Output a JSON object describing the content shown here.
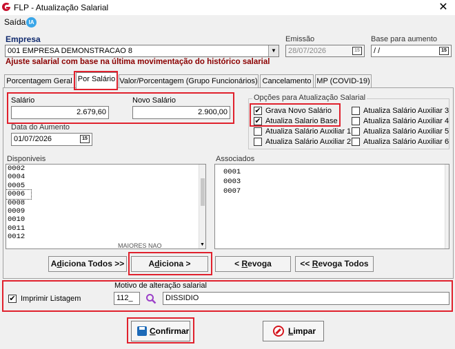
{
  "window": {
    "title": "FLP - Atualização Salarial",
    "close_glyph": "✕"
  },
  "menu": {
    "saida": "Saída",
    "ia_badge": "IA"
  },
  "empresa": {
    "label": "Empresa",
    "value": "001 EMPRESA DEMONSTRACAO 8",
    "emissao_label": "Emissão",
    "emissao_value": "28/07/2026",
    "base_label": "Base para aumento",
    "base_value": " / /"
  },
  "warning": "Ajuste salarial com base na última movimentação do histórico salarial",
  "tabs": [
    {
      "label": "Porcentagem Geral"
    },
    {
      "label": "Por Salário"
    },
    {
      "label": "Valor/Porcentagem (Grupo Funcionários)"
    },
    {
      "label": "Cancelamento"
    },
    {
      "label": "MP (COVID-19)"
    }
  ],
  "salario": {
    "label": "Salário",
    "value": "2.679,60",
    "novo_label": "Novo Salário",
    "novo_value": "2.900,00",
    "data_label": "Data do Aumento",
    "data_value": "01/07/2026"
  },
  "opcoes": {
    "title": "Opções para Atualização Salarial",
    "items": [
      {
        "label": "Grava Novo Salário",
        "checked": "✔"
      },
      {
        "label": "Atualiza Salario Base",
        "checked": "✔"
      },
      {
        "label": "Atualiza Salário Auxiliar 1",
        "checked": ""
      },
      {
        "label": "Atualiza Salário Auxiliar 2",
        "checked": ""
      },
      {
        "label": "Atualiza Salário Auxiliar 3",
        "checked": ""
      },
      {
        "label": "Atualiza Salário Auxiliar 4",
        "checked": ""
      },
      {
        "label": "Atualiza Salário Auxiliar 5",
        "checked": ""
      },
      {
        "label": "Atualiza Salário Auxiliar 6",
        "checked": ""
      }
    ]
  },
  "disponiveis": {
    "label": "Disponiveis",
    "items": [
      "0002",
      "0004",
      "0005",
      "0006",
      "0008",
      "0009",
      "0010",
      "0011",
      "0012"
    ],
    "partial_text": "MAIORES NAO"
  },
  "associados": {
    "label": "Associados",
    "items": [
      "0001",
      "0003",
      "0007"
    ]
  },
  "buttons": {
    "adiciona_todos_pre": "A",
    "adiciona_todos_ul": "d",
    "adiciona_todos_post": "iciona Todos >>",
    "adiciona_pre": "A",
    "adiciona_ul": "d",
    "adiciona_post": "iciona >",
    "revoga_pre": "< ",
    "revoga_ul": "R",
    "revoga_post": "evoga",
    "revoga_todos_pre": "<< ",
    "revoga_todos_ul": "R",
    "revoga_todos_post": "evoga Todos"
  },
  "motivo": {
    "imprimir_label": "Imprimir Listagem",
    "imprimir_checked": "✔",
    "title": "Motivo de alteração salarial",
    "code": "112_",
    "description": "DISSIDIO"
  },
  "footer": {
    "confirmar_ul": "C",
    "confirmar_post": "onfirmar",
    "limpar_ul": "L",
    "limpar_post": "impar"
  },
  "colors": {
    "accent_red": "#e0202c",
    "warning_text": "#8b0000",
    "label_blue": "#102a6e"
  }
}
